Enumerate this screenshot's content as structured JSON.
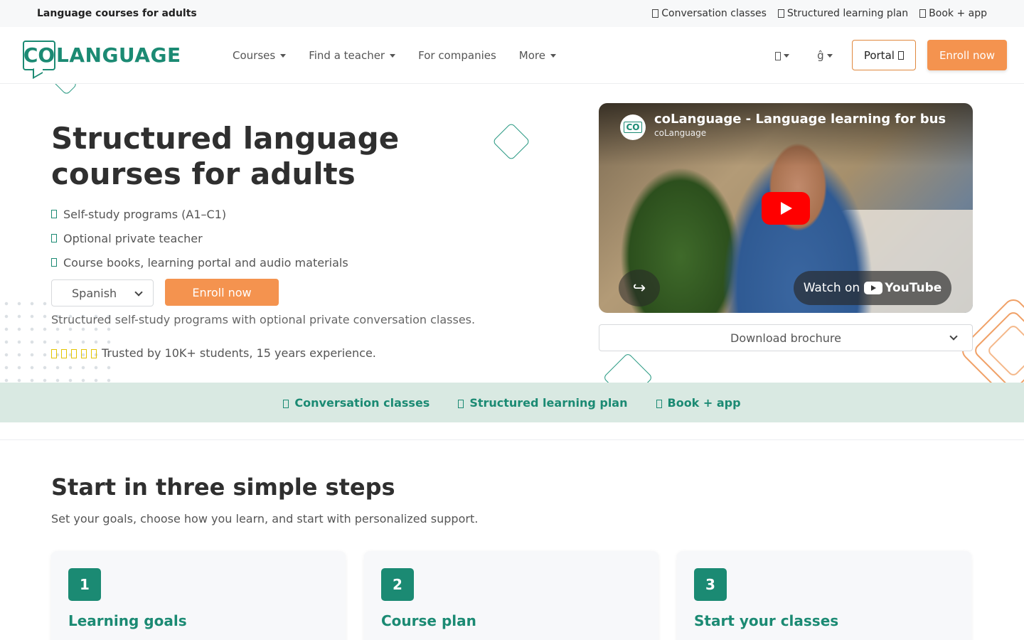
{
  "topbar": {
    "title": "Language courses for adults",
    "links": [
      "Conversation classes",
      "Structured learning plan",
      "Book + app"
    ]
  },
  "nav": {
    "logo_co": "CO",
    "logo_text": "LANGUAGE",
    "menu": [
      {
        "label": "Courses",
        "has_dropdown": true
      },
      {
        "label": "Find a teacher",
        "has_dropdown": true
      },
      {
        "label": "For companies",
        "has_dropdown": false
      },
      {
        "label": "More",
        "has_dropdown": true
      }
    ],
    "lang_glyph": "ĝ",
    "portal_label": "Portal",
    "enroll_label": "Enroll now"
  },
  "hero": {
    "title": "Structured language courses for adults",
    "features": [
      "Self-study programs (A1–C1)",
      "Optional private teacher",
      "Course books, learning portal and audio materials"
    ],
    "language_selected": "Spanish",
    "enroll_label": "Enroll now",
    "subtitle": "Structured self-study programs with optional private conversation classes.",
    "trust_text": "Trusted by 10K+ students, 15 years experience.",
    "rating_stars": 5
  },
  "video": {
    "channel_icon": "CO",
    "title": "coLanguage - Language learning for business",
    "channel": "coLanguage",
    "watch_on": "Watch on",
    "youtube": "YouTube"
  },
  "brochure": {
    "label": "Download brochure"
  },
  "band": {
    "items": [
      "Conversation classes",
      "Structured learning plan",
      "Book + app"
    ]
  },
  "steps": {
    "title": "Start in three simple steps",
    "subtitle": "Set your goals, choose how you learn, and start with personalized support.",
    "cards": [
      {
        "number": "1",
        "title": "Learning goals"
      },
      {
        "number": "2",
        "title": "Course plan"
      },
      {
        "number": "3",
        "title": "Start your classes"
      }
    ]
  },
  "colors": {
    "brand": "#1b8a73",
    "accent": "#f4934f",
    "band_bg": "#d9e9e2"
  }
}
